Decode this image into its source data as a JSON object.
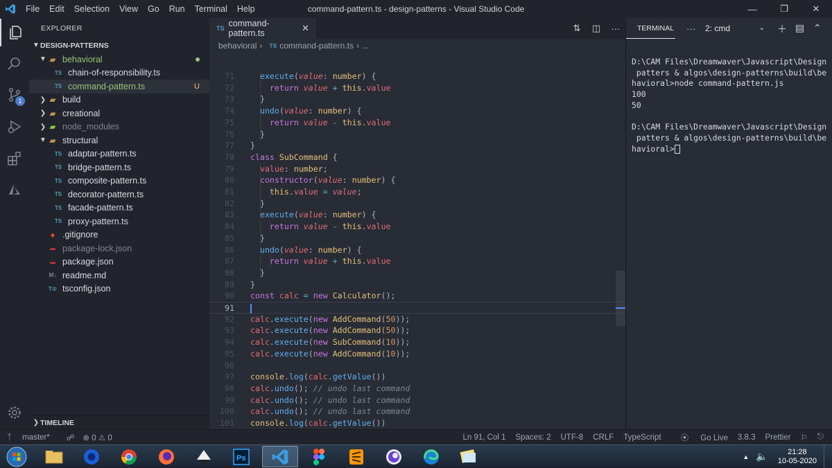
{
  "window": {
    "title": "command-pattern.ts - design-patterns - Visual Studio Code",
    "menu": [
      "File",
      "Edit",
      "Selection",
      "View",
      "Go",
      "Run",
      "Terminal",
      "Help"
    ]
  },
  "activity": {
    "scm_badge": "1"
  },
  "explorer": {
    "header": "EXPLORER",
    "root": "DESIGN-PATTERNS",
    "timeline": "TIMELINE",
    "items": [
      {
        "label": "behavioral",
        "kind": "folder-open",
        "depth": 1,
        "status": "dot"
      },
      {
        "label": "chain-of-responsibility.ts",
        "kind": "ts",
        "depth": 2
      },
      {
        "label": "command-pattern.ts",
        "kind": "ts",
        "depth": 2,
        "status": "U",
        "selected": true
      },
      {
        "label": "build",
        "kind": "folder",
        "depth": 1
      },
      {
        "label": "creational",
        "kind": "folder",
        "depth": 1
      },
      {
        "label": "node_modules",
        "kind": "node-folder",
        "depth": 1
      },
      {
        "label": "structural",
        "kind": "folder-open",
        "depth": 1
      },
      {
        "label": "adaptar-pattern.ts",
        "kind": "ts",
        "depth": 2
      },
      {
        "label": "bridge-pattern.ts",
        "kind": "ts",
        "depth": 2
      },
      {
        "label": "composite-pattern.ts",
        "kind": "ts",
        "depth": 2
      },
      {
        "label": "decorator-pattern.ts",
        "kind": "ts",
        "depth": 2
      },
      {
        "label": "facade-pattern.ts",
        "kind": "ts",
        "depth": 2
      },
      {
        "label": "proxy-pattern.ts",
        "kind": "ts",
        "depth": 2
      },
      {
        "label": ".gitignore",
        "kind": "git",
        "depth": 1
      },
      {
        "label": "package-lock.json",
        "kind": "npm",
        "depth": 1
      },
      {
        "label": "package.json",
        "kind": "npm",
        "depth": 1
      },
      {
        "label": "readme.md",
        "kind": "md",
        "depth": 1
      },
      {
        "label": "tsconfig.json",
        "kind": "tsconfig",
        "depth": 1
      }
    ]
  },
  "editor": {
    "tab_label": "command-pattern.ts",
    "tab_icon": "TS",
    "breadcrumb": [
      "behavioral",
      "command-pattern.ts",
      "..."
    ],
    "cursor_line": "91",
    "lines": [
      {
        "n": "71",
        "ind": 1,
        "tok": [
          [
            "f",
            "execute"
          ],
          [
            "pl",
            "("
          ],
          [
            "p",
            "value"
          ],
          [
            "pl",
            ": "
          ],
          [
            "t",
            "number"
          ],
          [
            "pl",
            ") {"
          ]
        ]
      },
      {
        "n": "72",
        "ind": 2,
        "tok": [
          [
            "k",
            "return "
          ],
          [
            "p",
            "value"
          ],
          [
            "op",
            " + "
          ],
          [
            "th",
            "this"
          ],
          [
            "pl",
            "."
          ],
          [
            "p2",
            "value"
          ]
        ]
      },
      {
        "n": "73",
        "ind": 1,
        "tok": [
          [
            "pl",
            "}"
          ]
        ]
      },
      {
        "n": "74",
        "ind": 1,
        "tok": [
          [
            "f",
            "undo"
          ],
          [
            "pl",
            "("
          ],
          [
            "p",
            "value"
          ],
          [
            "pl",
            ": "
          ],
          [
            "t",
            "number"
          ],
          [
            "pl",
            ") {"
          ]
        ]
      },
      {
        "n": "75",
        "ind": 2,
        "tok": [
          [
            "k",
            "return "
          ],
          [
            "p",
            "value"
          ],
          [
            "op",
            " - "
          ],
          [
            "th",
            "this"
          ],
          [
            "pl",
            "."
          ],
          [
            "p2",
            "value"
          ]
        ]
      },
      {
        "n": "76",
        "ind": 1,
        "tok": [
          [
            "pl",
            "}"
          ]
        ]
      },
      {
        "n": "77",
        "ind": 0,
        "tok": [
          [
            "pl",
            "}"
          ]
        ]
      },
      {
        "n": "78",
        "ind": 0,
        "tok": [
          [
            "k",
            "class "
          ],
          [
            "t",
            "SubCommand"
          ],
          [
            "pl",
            " {"
          ]
        ]
      },
      {
        "n": "79",
        "ind": 1,
        "tok": [
          [
            "p2",
            "value"
          ],
          [
            "pl",
            ": "
          ],
          [
            "t",
            "number"
          ],
          [
            "pl",
            ";"
          ]
        ]
      },
      {
        "n": "80",
        "ind": 1,
        "tok": [
          [
            "k",
            "constructor"
          ],
          [
            "pl",
            "("
          ],
          [
            "p",
            "value"
          ],
          [
            "pl",
            ": "
          ],
          [
            "t",
            "number"
          ],
          [
            "pl",
            ") {"
          ]
        ]
      },
      {
        "n": "81",
        "ind": 2,
        "tok": [
          [
            "th",
            "this"
          ],
          [
            "pl",
            "."
          ],
          [
            "p2",
            "value"
          ],
          [
            "op",
            " = "
          ],
          [
            "p",
            "value"
          ],
          [
            "pl",
            ";"
          ]
        ]
      },
      {
        "n": "82",
        "ind": 1,
        "tok": [
          [
            "pl",
            "}"
          ]
        ]
      },
      {
        "n": "83",
        "ind": 1,
        "tok": [
          [
            "f",
            "execute"
          ],
          [
            "pl",
            "("
          ],
          [
            "p",
            "value"
          ],
          [
            "pl",
            ": "
          ],
          [
            "t",
            "number"
          ],
          [
            "pl",
            ") {"
          ]
        ]
      },
      {
        "n": "84",
        "ind": 2,
        "tok": [
          [
            "k",
            "return "
          ],
          [
            "p",
            "value"
          ],
          [
            "op",
            " - "
          ],
          [
            "th",
            "this"
          ],
          [
            "pl",
            "."
          ],
          [
            "p2",
            "value"
          ]
        ]
      },
      {
        "n": "85",
        "ind": 1,
        "tok": [
          [
            "pl",
            "}"
          ]
        ]
      },
      {
        "n": "86",
        "ind": 1,
        "tok": [
          [
            "f",
            "undo"
          ],
          [
            "pl",
            "("
          ],
          [
            "p",
            "value"
          ],
          [
            "pl",
            ": "
          ],
          [
            "t",
            "number"
          ],
          [
            "pl",
            ") {"
          ]
        ]
      },
      {
        "n": "87",
        "ind": 2,
        "tok": [
          [
            "k",
            "return "
          ],
          [
            "p",
            "value"
          ],
          [
            "op",
            " + "
          ],
          [
            "th",
            "this"
          ],
          [
            "pl",
            "."
          ],
          [
            "p2",
            "value"
          ]
        ]
      },
      {
        "n": "88",
        "ind": 1,
        "tok": [
          [
            "pl",
            "}"
          ]
        ]
      },
      {
        "n": "89",
        "ind": 0,
        "tok": [
          [
            "pl",
            "}"
          ]
        ]
      },
      {
        "n": "90",
        "ind": 0,
        "tok": [
          [
            "k",
            "const "
          ],
          [
            "p2",
            "calc"
          ],
          [
            "op",
            " = "
          ],
          [
            "k",
            "new "
          ],
          [
            "t",
            "Calculator"
          ],
          [
            "pl",
            "();"
          ]
        ]
      },
      {
        "n": "91",
        "ind": 0,
        "tok": [],
        "cursor": true
      },
      {
        "n": "92",
        "ind": 0,
        "tok": [
          [
            "p2",
            "calc"
          ],
          [
            "pl",
            "."
          ],
          [
            "f",
            "execute"
          ],
          [
            "pl",
            "("
          ],
          [
            "k",
            "new "
          ],
          [
            "t",
            "AddCommand"
          ],
          [
            "pl",
            "("
          ],
          [
            "n",
            "50"
          ],
          [
            "pl",
            "));"
          ]
        ]
      },
      {
        "n": "93",
        "ind": 0,
        "tok": [
          [
            "p2",
            "calc"
          ],
          [
            "pl",
            "."
          ],
          [
            "f",
            "execute"
          ],
          [
            "pl",
            "("
          ],
          [
            "k",
            "new "
          ],
          [
            "t",
            "AddCommand"
          ],
          [
            "pl",
            "("
          ],
          [
            "n",
            "50"
          ],
          [
            "pl",
            "));"
          ]
        ]
      },
      {
        "n": "94",
        "ind": 0,
        "tok": [
          [
            "p2",
            "calc"
          ],
          [
            "pl",
            "."
          ],
          [
            "f",
            "execute"
          ],
          [
            "pl",
            "("
          ],
          [
            "k",
            "new "
          ],
          [
            "t",
            "SubCommand"
          ],
          [
            "pl",
            "("
          ],
          [
            "n",
            "10"
          ],
          [
            "pl",
            "));"
          ]
        ]
      },
      {
        "n": "95",
        "ind": 0,
        "tok": [
          [
            "p2",
            "calc"
          ],
          [
            "pl",
            "."
          ],
          [
            "f",
            "execute"
          ],
          [
            "pl",
            "("
          ],
          [
            "k",
            "new "
          ],
          [
            "t",
            "AddCommand"
          ],
          [
            "pl",
            "("
          ],
          [
            "n",
            "10"
          ],
          [
            "pl",
            "));"
          ]
        ]
      },
      {
        "n": "96",
        "ind": 0,
        "tok": []
      },
      {
        "n": "97",
        "ind": 0,
        "tok": [
          [
            "t",
            "console"
          ],
          [
            "pl",
            "."
          ],
          [
            "f",
            "log"
          ],
          [
            "pl",
            "("
          ],
          [
            "p2",
            "calc"
          ],
          [
            "pl",
            "."
          ],
          [
            "f",
            "getValue"
          ],
          [
            "pl",
            "())"
          ]
        ]
      },
      {
        "n": "98",
        "ind": 0,
        "tok": [
          [
            "p2",
            "calc"
          ],
          [
            "pl",
            "."
          ],
          [
            "f",
            "undo"
          ],
          [
            "pl",
            "(); "
          ],
          [
            "c",
            "// undo last command"
          ]
        ]
      },
      {
        "n": "99",
        "ind": 0,
        "tok": [
          [
            "p2",
            "calc"
          ],
          [
            "pl",
            "."
          ],
          [
            "f",
            "undo"
          ],
          [
            "pl",
            "(); "
          ],
          [
            "c",
            "// undo last command"
          ]
        ]
      },
      {
        "n": "100",
        "ind": 0,
        "tok": [
          [
            "p2",
            "calc"
          ],
          [
            "pl",
            "."
          ],
          [
            "f",
            "undo"
          ],
          [
            "pl",
            "(); "
          ],
          [
            "c",
            "// undo last command"
          ]
        ]
      },
      {
        "n": "101",
        "ind": 0,
        "tok": [
          [
            "t",
            "console"
          ],
          [
            "pl",
            "."
          ],
          [
            "f",
            "log"
          ],
          [
            "pl",
            "("
          ],
          [
            "p2",
            "calc"
          ],
          [
            "pl",
            "."
          ],
          [
            "f",
            "getValue"
          ],
          [
            "pl",
            "())"
          ]
        ]
      }
    ]
  },
  "terminal": {
    "tab": "TERMINAL",
    "more": "···",
    "selected_shell": "2: cmd",
    "lines": [
      "D:\\CAM Files\\Dreamwaver\\Javascript\\Design",
      " patters & algos\\design-patterns\\build\\be",
      "havioral>node command-pattern.js",
      "100",
      "50",
      "",
      "D:\\CAM Files\\Dreamwaver\\Javascript\\Design",
      " patters & algos\\design-patterns\\build\\be",
      "havioral>"
    ]
  },
  "statusbar": {
    "branch": "master*",
    "problems": "⊗ 0 ⚠ 0",
    "position": "Ln 91, Col 1",
    "spaces": "Spaces: 2",
    "encoding": "UTF-8",
    "eol": "CRLF",
    "language": "TypeScript",
    "golive": "Go Live",
    "version": "3.8.3",
    "formatter": "Prettier"
  },
  "taskbar": {
    "time": "21:28",
    "date": "10-05-2020"
  },
  "colors": {
    "keyword": "#c678dd",
    "function": "#61afef",
    "param": "#e06c75",
    "type": "#e5c07b",
    "number": "#d19a66",
    "comment": "#7f848e",
    "accent": "#4d78cc"
  }
}
